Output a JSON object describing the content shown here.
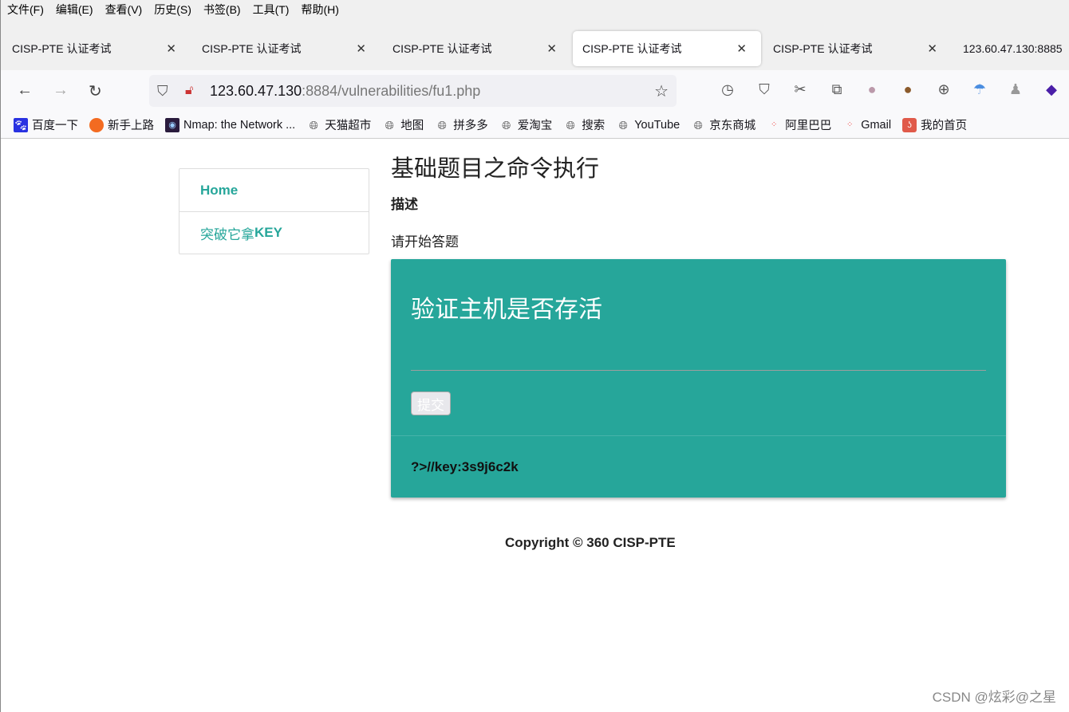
{
  "menu": [
    "文件(F)",
    "编辑(E)",
    "查看(V)",
    "历史(S)",
    "书签(B)",
    "工具(T)",
    "帮助(H)"
  ],
  "tabs": [
    {
      "label": "CISP-PTE 认证考试"
    },
    {
      "label": "CISP-PTE 认证考试"
    },
    {
      "label": "CISP-PTE 认证考试"
    },
    {
      "label": "CISP-PTE 认证考试",
      "active": true
    },
    {
      "label": "CISP-PTE 认证考试"
    },
    {
      "label": "123.60.47.130:8885"
    }
  ],
  "url": {
    "host": "123.60.47.130",
    "path": ":8884/vulnerabilities/fu1.php"
  },
  "bookmarks": [
    "百度一下",
    "新手上路",
    "Nmap: the Network ...",
    "天猫超市",
    "地图",
    "拼多多",
    "爱淘宝",
    "搜索",
    "YouTube",
    "京东商城",
    "阿里巴巴",
    "Gmail",
    "我的首页"
  ],
  "sidebar": {
    "home": "Home",
    "key_cn": "突破它拿",
    "key_en": "KEY"
  },
  "main": {
    "title": "基础题目之命令执行",
    "desc": "描述",
    "intro": "请开始答题"
  },
  "card": {
    "title": "验证主机是否存活",
    "submit": "提交",
    "key": "?>//key:3s9j6c2k"
  },
  "footer": "Copyright © 360 CISP-PTE",
  "watermark": "CSDN @炫彩@之星",
  "colors": {
    "accent": "#26a69a"
  }
}
